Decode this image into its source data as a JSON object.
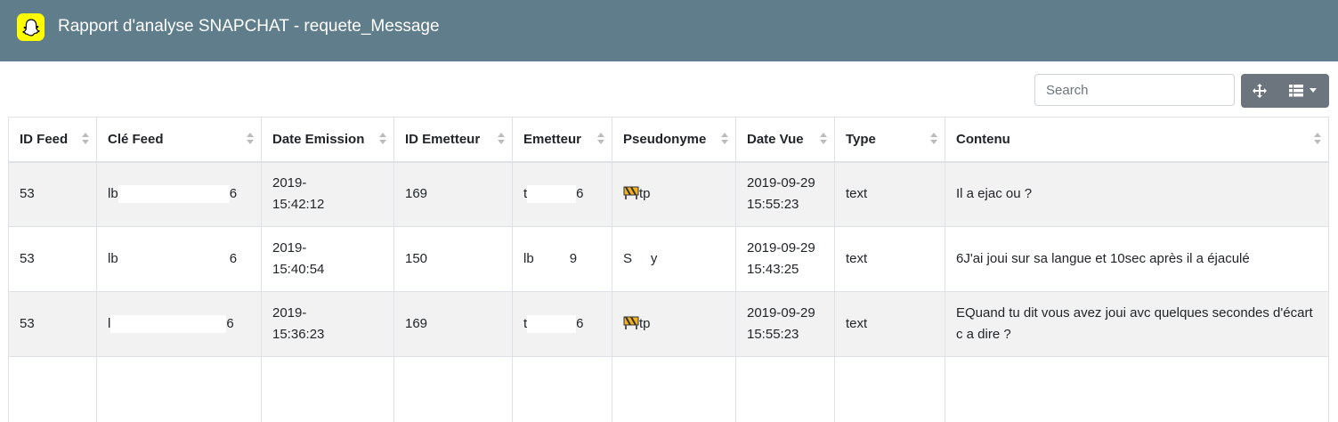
{
  "header": {
    "title": "Rapport d'analyse SNAPCHAT - requete_Message",
    "logo_icon": "snapchat-ghost-icon",
    "background": "#607d8b"
  },
  "toolbar": {
    "search_placeholder": "Search",
    "move_icon": "move-arrows-icon",
    "columns_icon": "list-columns-icon",
    "dropdown_icon": "caret-down-icon"
  },
  "table": {
    "columns": [
      "ID Feed",
      "Clé Feed",
      "Date Emission",
      "ID Emetteur",
      "Emetteur",
      "Pseudonyme",
      "Date Vue",
      "Type",
      "Contenu"
    ],
    "rows": [
      {
        "id_feed": "53",
        "cle_a": "lb",
        "cle_b": "6",
        "date_emission_1": "2019-",
        "date_emission_2": "15:42:12",
        "id_emetteur": "169",
        "emetteur_a": "t",
        "emetteur_b": "6",
        "pseudonyme": "tp",
        "date_vue_1": "2019-09-29",
        "date_vue_2": "15:55:23",
        "type": "text",
        "contenu": "Il a ejac ou ?"
      },
      {
        "id_feed": "53",
        "cle_a": "lb",
        "cle_b": "6",
        "date_emission_1": "2019-",
        "date_emission_2": "15:40:54",
        "id_emetteur": "150",
        "emetteur_a": "lb",
        "emetteur_b": "9",
        "pseudonyme": "S     y",
        "date_vue_1": "2019-09-29",
        "date_vue_2": "15:43:25",
        "type": "text",
        "contenu": "6J'ai joui sur sa langue et 10sec après il a éjaculé"
      },
      {
        "id_feed": "53",
        "cle_a": "l",
        "cle_b": "6",
        "date_emission_1": "2019-",
        "date_emission_2": "15:36:23",
        "id_emetteur": "169",
        "emetteur_a": "t",
        "emetteur_b": "6",
        "pseudonyme": "tp",
        "date_vue_1": "2019-09-29",
        "date_vue_2": "15:55:23",
        "type": "text",
        "contenu": "EQuand tu dit vous avez joui avc quelques secondes d'écart c a dire ?"
      }
    ]
  }
}
